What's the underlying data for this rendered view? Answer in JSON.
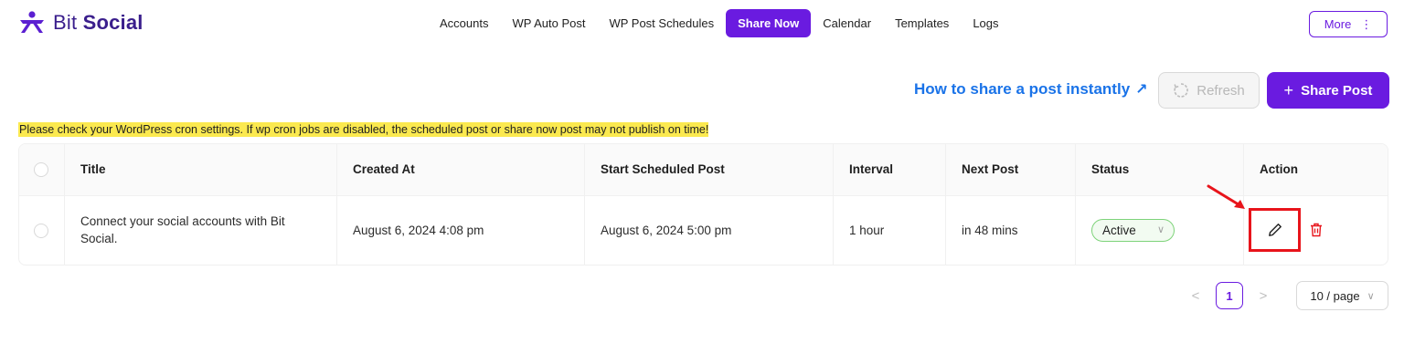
{
  "brand": {
    "prefix": "Bit",
    "name": "Social"
  },
  "nav": {
    "items": [
      {
        "label": "Accounts",
        "active": false
      },
      {
        "label": "WP Auto Post",
        "active": false
      },
      {
        "label": "WP Post Schedules",
        "active": false
      },
      {
        "label": "Share Now",
        "active": true
      },
      {
        "label": "Calendar",
        "active": false
      },
      {
        "label": "Templates",
        "active": false
      },
      {
        "label": "Logs",
        "active": false
      }
    ],
    "more_label": "More",
    "more_icon": "⋮"
  },
  "toolbar": {
    "help_link": "How to share a post instantly",
    "help_icon": "↗",
    "refresh_label": "Refresh",
    "share_label": "Share Post",
    "share_icon": "+"
  },
  "warning": "Please check your WordPress cron settings. If wp cron jobs are disabled, the scheduled post or share now post may not publish on time!",
  "table": {
    "columns": [
      "Title",
      "Created At",
      "Start Scheduled Post",
      "Interval",
      "Next Post",
      "Status",
      "Action"
    ],
    "rows": [
      {
        "title": "Connect your social accounts with Bit Social.",
        "created_at": "August 6, 2024 4:08 pm",
        "start_scheduled": "August 6, 2024 5:00 pm",
        "interval": "1 hour",
        "next_post": "in 48 mins",
        "status": "Active"
      }
    ]
  },
  "pagination": {
    "current_page": "1",
    "prev_icon": "<",
    "next_icon": ">",
    "page_size": "10 / page"
  },
  "colors": {
    "accent": "#6a1be0",
    "link": "#1a73e8",
    "warning_bg": "#fbe94f",
    "status_border": "#7ed37a",
    "highlight_red": "#e8141b"
  }
}
